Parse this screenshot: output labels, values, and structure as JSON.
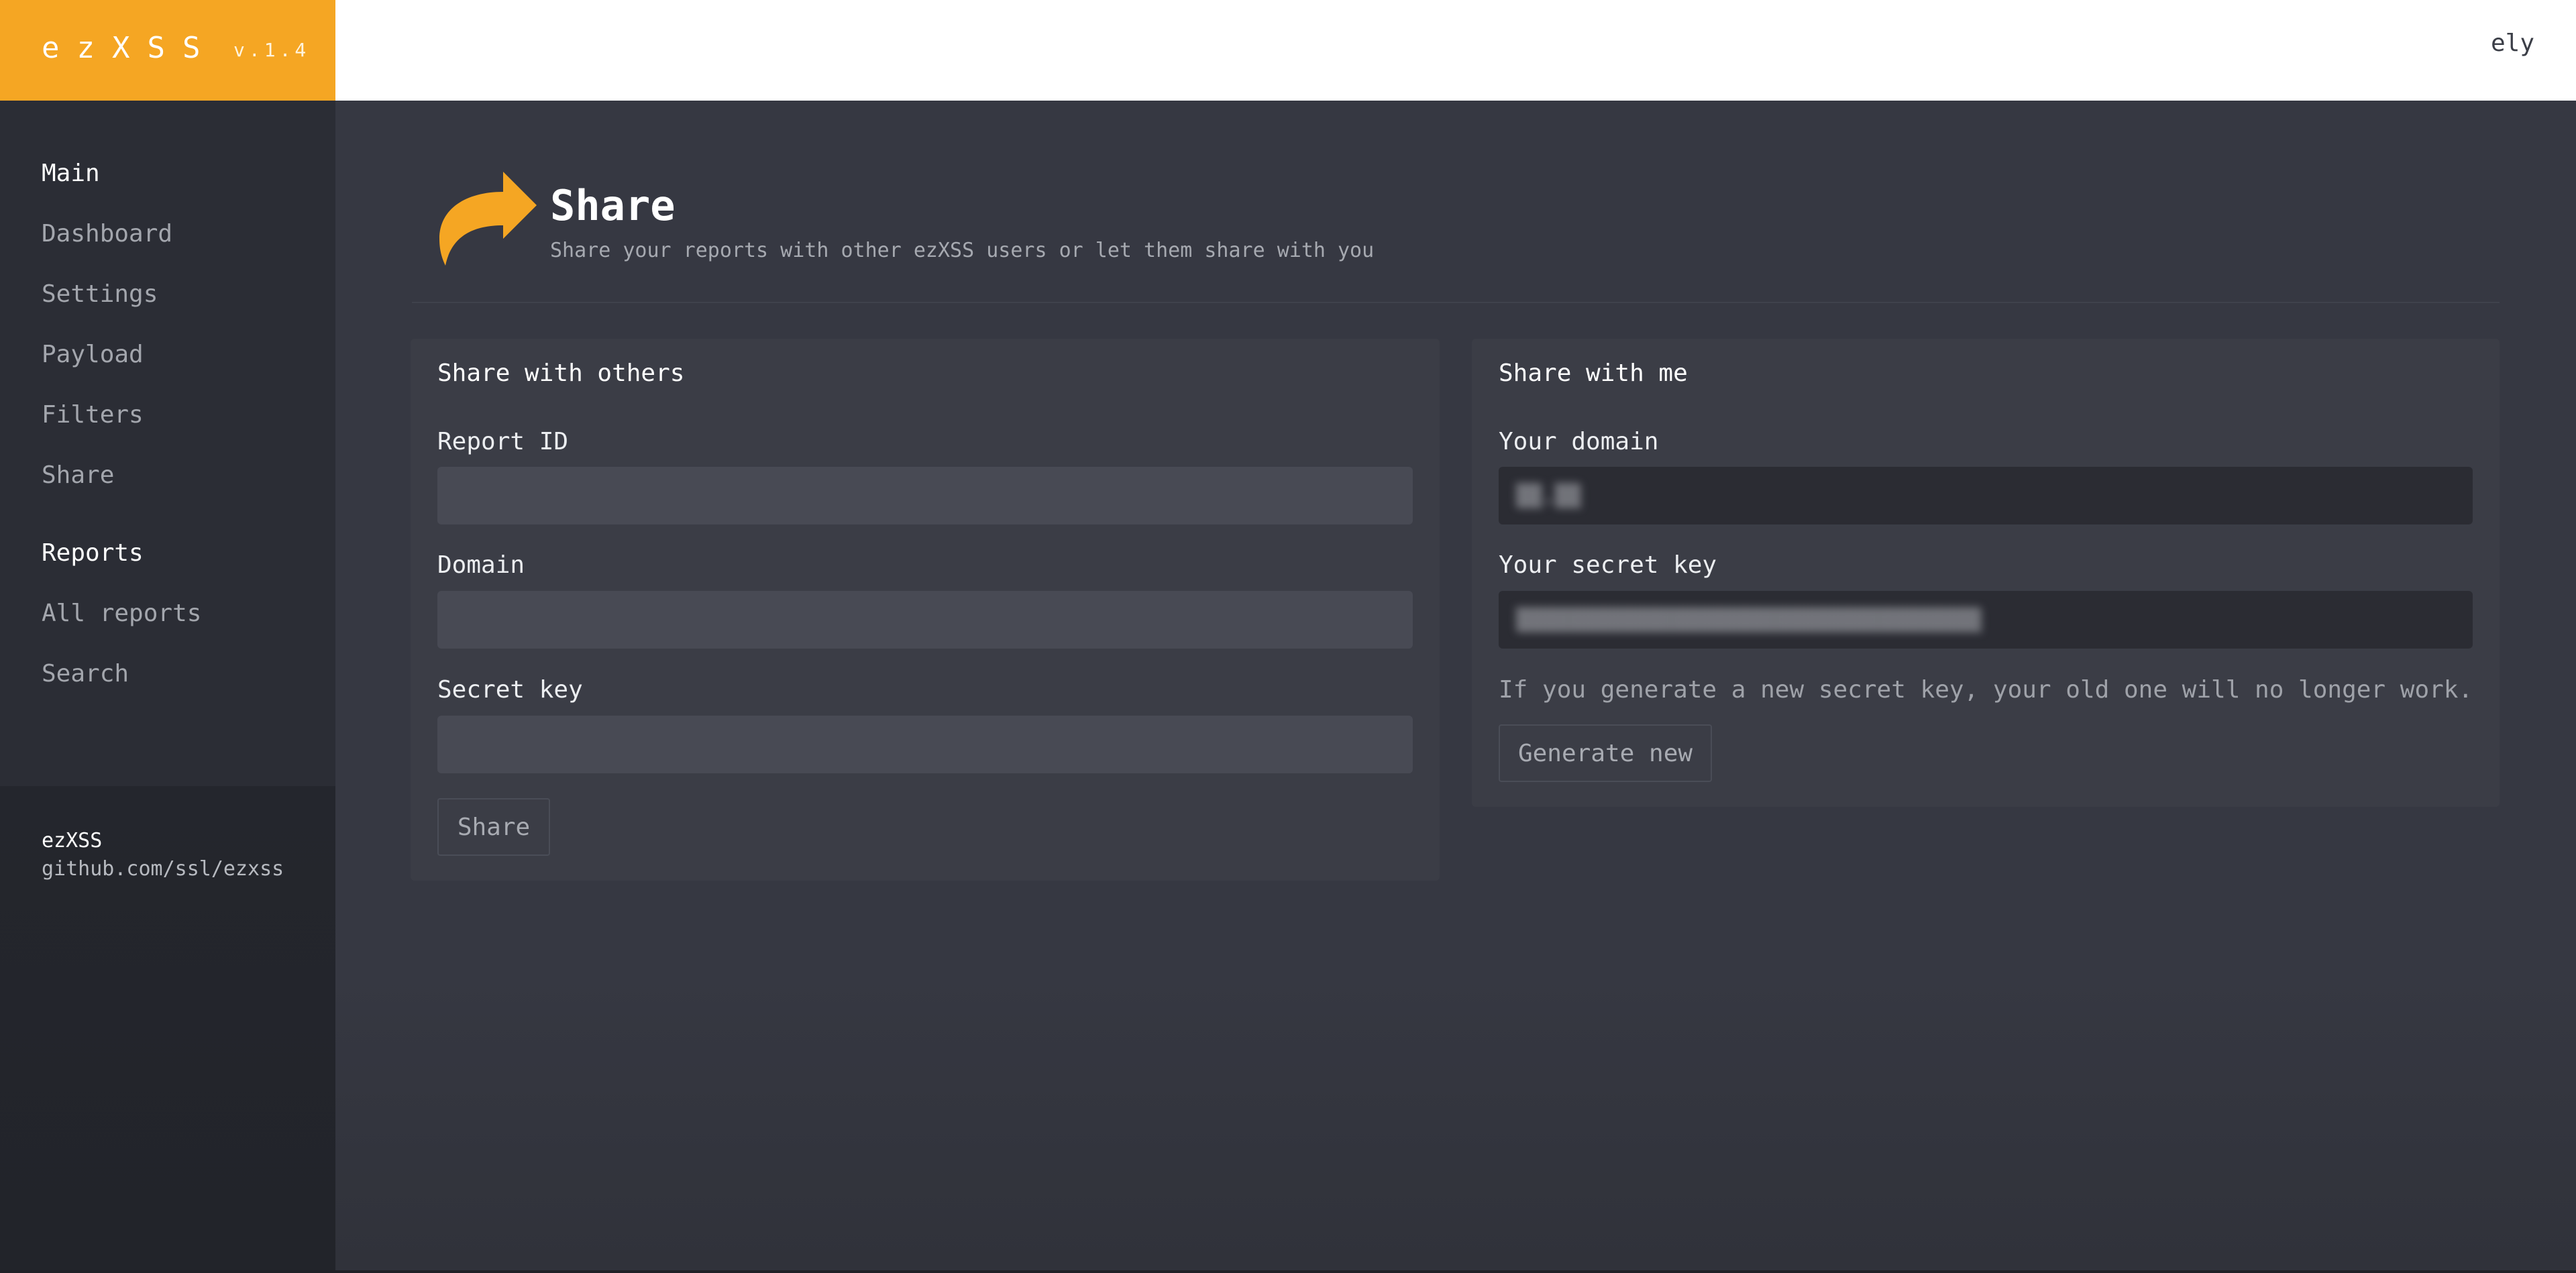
{
  "app": {
    "name": "ezXSS",
    "version": "v.1.4",
    "user": "ely",
    "accent": "#f5a623"
  },
  "sidebar": {
    "sections": [
      {
        "heading": "Main",
        "items": [
          "Dashboard",
          "Settings",
          "Payload",
          "Filters",
          "Share"
        ]
      },
      {
        "heading": "Reports",
        "items": [
          "All reports",
          "Search"
        ]
      }
    ],
    "footer": {
      "name": "ezXSS",
      "link": "github.com/ssl/ezxss"
    }
  },
  "page": {
    "icon": "share-arrow-icon",
    "title": "Share",
    "subtitle": "Share your reports with other ezXSS users or let them share with you"
  },
  "share_with_others": {
    "title": "Share with others",
    "report_id_label": "Report ID",
    "report_id_value": "",
    "domain_label": "Domain",
    "domain_value": "",
    "secret_key_label": "Secret key",
    "secret_key_value": "",
    "button": "Share"
  },
  "share_with_me": {
    "title": "Share with me",
    "domain_label": "Your domain",
    "domain_value": "▒▒.▒▒",
    "secret_key_label": "Your secret key",
    "secret_key_value": "▒▒▒▒▒▒▒▒▒▒▒▒▒▒▒▒▒▒▒▒▒▒▒▒▒▒▒▒▒▒▒▒▒▒▒▒",
    "note": "If you generate a new secret key, your old one will no longer work.",
    "button": "Generate new"
  }
}
